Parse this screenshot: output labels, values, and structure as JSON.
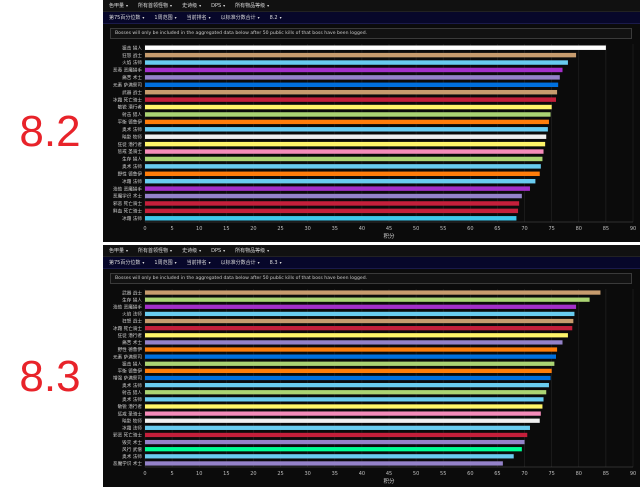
{
  "labels": {
    "top": "8.2",
    "bottom": "8.3"
  },
  "nav1": [
    "色甲量",
    "所有首领怪物",
    "史诗级",
    "DPS",
    "所有物品等级"
  ],
  "nav2_top": [
    "第75百分位数",
    "1周范围",
    "当前排名",
    "以标准分数合计",
    "8.2"
  ],
  "nav2_bottom": [
    "第75百分位数",
    "1周范围",
    "当前排名",
    "以标准分数合计",
    "8.3"
  ],
  "notice": "Bosses will only be included in the aggregated data below after 50 public kills of that boss have been logged.",
  "chart_data": [
    {
      "type": "bar",
      "orientation": "horizontal",
      "xlabel": "积分",
      "xlim": [
        0,
        90
      ],
      "xticks": [
        0,
        5,
        10,
        15,
        20,
        25,
        30,
        35,
        40,
        45,
        50,
        55,
        60,
        65,
        70,
        75,
        80,
        85,
        90
      ],
      "categories": [
        "狙击 猎人",
        "狂怒 战士",
        "火焰 法师",
        "恶毒 恶魔猎手",
        "痛苦 术士",
        "元素 萨满祭司",
        "武器 战士",
        "冰霜 死亡骑士",
        "敏锐 潜行者",
        "射击 猎人",
        "平衡 德鲁伊",
        "奥术 法师",
        "暗影 牧师",
        "狂徒 潜行者",
        "惩戒 圣骑士",
        "生存 猎人",
        "奥术 法师",
        "野性 德鲁伊",
        "冰霜 法师",
        "浩劫 恶魔猎手",
        "恶魔学识 术士",
        "邪恶 死亡骑士",
        "鲜血 死亡骑士",
        "冰霜 法师"
      ],
      "values": [
        85,
        79.5,
        78,
        77,
        76.5,
        76.2,
        76,
        75.8,
        75,
        74.8,
        74.5,
        74.3,
        74,
        73.8,
        73.5,
        73.3,
        73,
        72.8,
        72,
        71,
        69.5,
        69,
        68.8,
        68.5
      ],
      "colors": [
        "#ffffff",
        "#c79c6e",
        "#69ccf0",
        "#a330c9",
        "#9482c9",
        "#0070de",
        "#c79c6e",
        "#c41f3b",
        "#fff569",
        "#abd473",
        "#ff7d0a",
        "#69ccf0",
        "#f0f0f0",
        "#fff569",
        "#f58cba",
        "#abd473",
        "#69ccf0",
        "#ff7d0a",
        "#69ccf0",
        "#a330c9",
        "#9482c9",
        "#c41f3b",
        "#c41f3b",
        "#3fc7eb"
      ]
    },
    {
      "type": "bar",
      "orientation": "horizontal",
      "xlabel": "积分",
      "xlim": [
        0,
        90
      ],
      "xticks": [
        0,
        5,
        10,
        15,
        20,
        25,
        30,
        35,
        40,
        45,
        50,
        55,
        60,
        65,
        70,
        75,
        80,
        85,
        90
      ],
      "categories": [
        "武器 战士",
        "生存 猎人",
        "浩劫 恶魔猎手",
        "火焰 法师",
        "狂怒 战士",
        "冰霜 死亡骑士",
        "狂徒 潜行者",
        "痛苦 术士",
        "野性 德鲁伊",
        "元素 萨满祭司",
        "狙击 猎人",
        "平衡 德鲁伊",
        "增强 萨满祭司",
        "奥术 法师",
        "射击 猎人",
        "奥术 法师",
        "敏锐 潜行者",
        "惩戒 圣骑士",
        "暗影 牧师",
        "冰霜 法师",
        "邪恶 死亡骑士",
        "毁灭 术士",
        "风行 武僧",
        "奥术 法师",
        "恶魔学识 术士"
      ],
      "values": [
        84,
        82,
        79.5,
        79.2,
        79,
        78.8,
        78,
        77,
        76,
        75.8,
        75.5,
        75,
        74.8,
        74.5,
        74,
        73.5,
        73.3,
        73,
        72.8,
        71,
        70.5,
        70,
        69.5,
        68,
        66
      ],
      "colors": [
        "#c79c6e",
        "#abd473",
        "#a330c9",
        "#69ccf0",
        "#c79c6e",
        "#c41f3b",
        "#fff569",
        "#9482c9",
        "#ff7d0a",
        "#0070de",
        "#abd473",
        "#ff7d0a",
        "#0070de",
        "#69ccf0",
        "#abd473",
        "#69ccf0",
        "#fff569",
        "#f58cba",
        "#f0f0f0",
        "#69ccf0",
        "#c41f3b",
        "#9482c9",
        "#00ff96",
        "#69ccf0",
        "#9482c9"
      ]
    }
  ]
}
